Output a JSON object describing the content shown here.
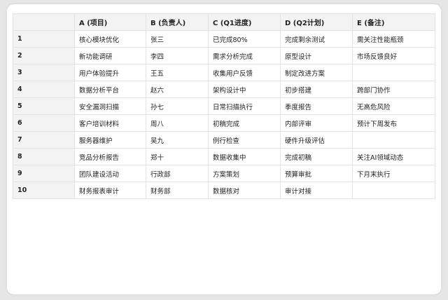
{
  "columns": [
    "",
    "A (项目)",
    "B (负责人)",
    "C (Q1进度)",
    "D (Q2计划)",
    "E (备注)"
  ],
  "rows": [
    {
      "num": "1",
      "cells": [
        "核心模块优化",
        "张三",
        "已完成80%",
        "完成剩余测试",
        "需关注性能瓶颈"
      ]
    },
    {
      "num": "2",
      "cells": [
        "新功能调研",
        "李四",
        "需求分析完成",
        "原型设计",
        "市场反馈良好"
      ]
    },
    {
      "num": "3",
      "cells": [
        "用户体验提升",
        "王五",
        "收集用户反馈",
        "制定改进方案",
        ""
      ]
    },
    {
      "num": "4",
      "cells": [
        "数据分析平台",
        "赵六",
        "架构设计中",
        "初步搭建",
        "跨部门协作"
      ]
    },
    {
      "num": "5",
      "cells": [
        "安全漏洞扫描",
        "孙七",
        "日常扫描执行",
        "季度报告",
        "无高危风险"
      ]
    },
    {
      "num": "6",
      "cells": [
        "客户培训材料",
        "周八",
        "初稿完成",
        "内部评审",
        "预计下周发布"
      ]
    },
    {
      "num": "7",
      "cells": [
        "服务器维护",
        "吴九",
        "例行检查",
        "硬件升级评估",
        ""
      ]
    },
    {
      "num": "8",
      "cells": [
        "竞品分析报告",
        "郑十",
        "数据收集中",
        "完成初稿",
        "关注AI领域动态"
      ]
    },
    {
      "num": "9",
      "cells": [
        "团队建设活动",
        "行政部",
        "方案策划",
        "预算审批",
        "下月末执行"
      ]
    },
    {
      "num": "10",
      "cells": [
        "财务报表审计",
        "财务部",
        "数据核对",
        "审计对接",
        ""
      ]
    }
  ]
}
